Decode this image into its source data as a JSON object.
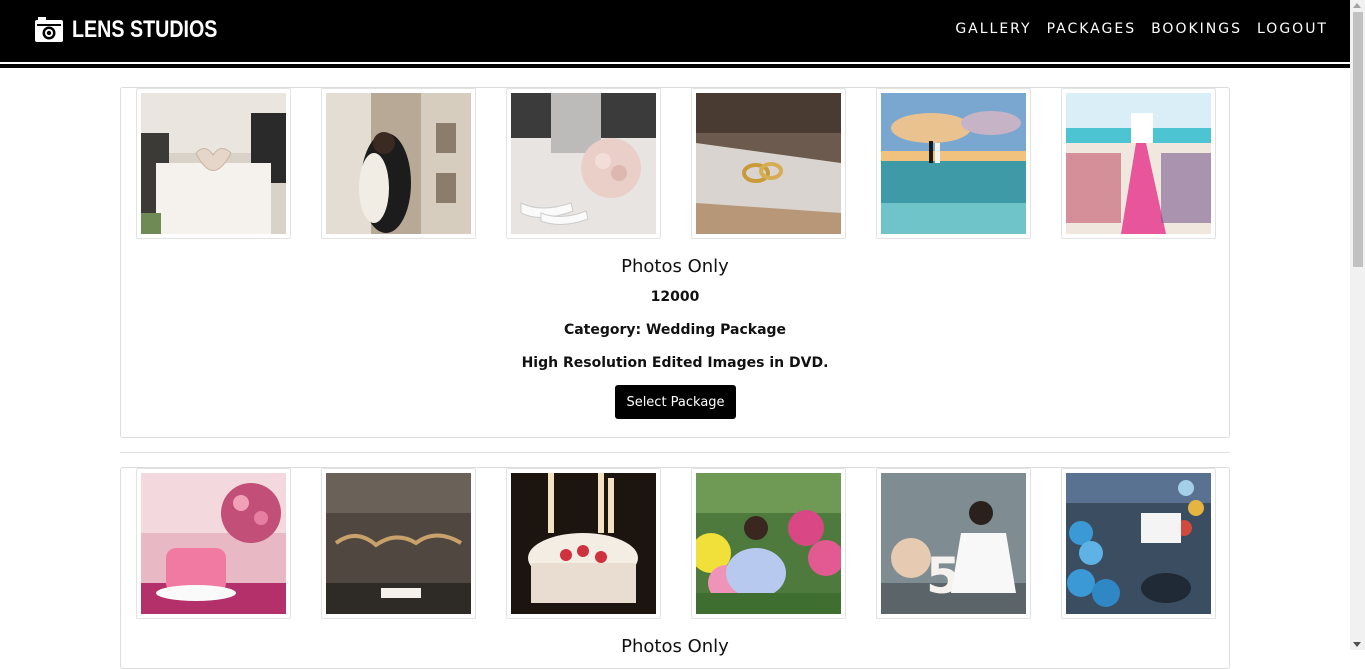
{
  "brand": {
    "name": "LENS STUDIOS",
    "icon": "camera-icon"
  },
  "nav": {
    "links": [
      "GALLERY",
      "PACKAGES",
      "BOOKINGS",
      "LOGOUT"
    ]
  },
  "packages": [
    {
      "title": "Photos Only",
      "price": "12000",
      "category": "Category: Wedding Package",
      "description": "High Resolution Edited Images in DVD.",
      "button_label": "Select Package",
      "images": [
        "wedding-hands-heart",
        "couple-kissing",
        "shoes-bouquet",
        "wedding-rings",
        "beach-couple-sunset",
        "beach-ceremony-aisle"
      ]
    },
    {
      "title": "Photos Only",
      "images": [
        "pink-cake-flowers",
        "happy-birthday-balloons",
        "birthday-cake-candles",
        "baby-balloons",
        "girl-teddy-five",
        "boy-balloons-party"
      ]
    }
  ],
  "colors": {
    "navbar": "#000000",
    "button": "#000000",
    "card_border": "#dcdcdc"
  }
}
